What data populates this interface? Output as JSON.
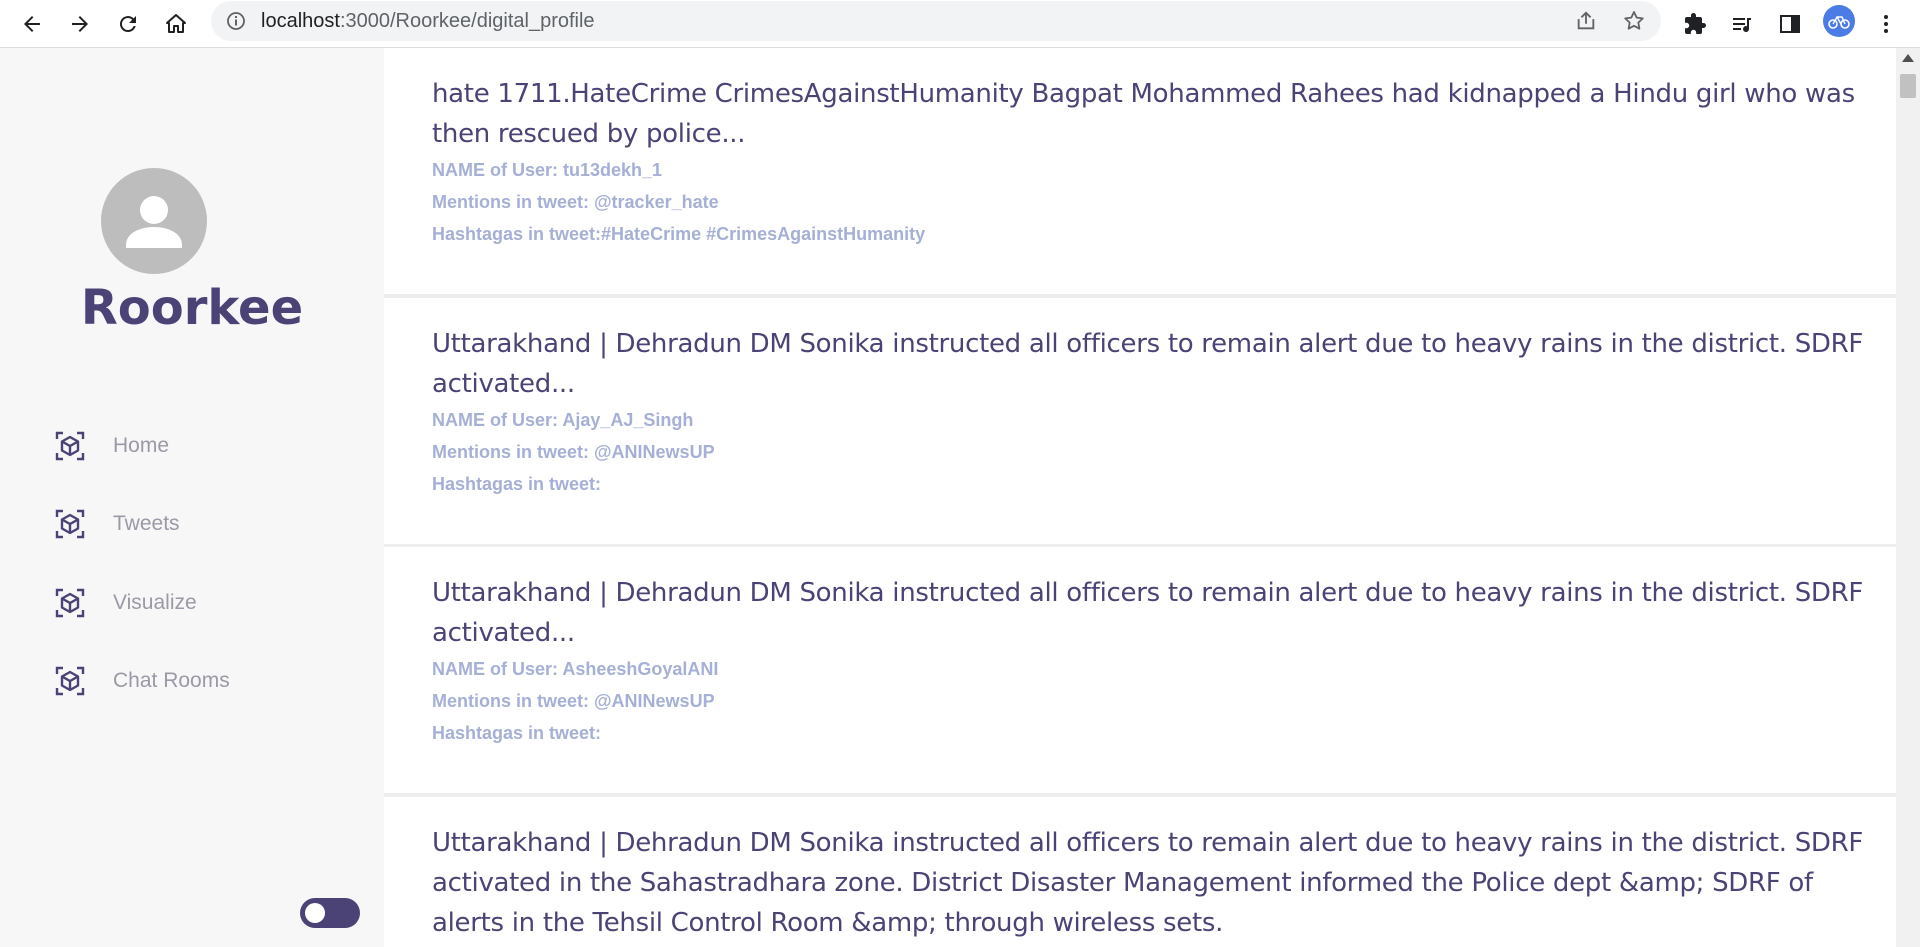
{
  "browser": {
    "url_host": "localhost",
    "url_path": ":3000/Roorkee/digital_profile"
  },
  "sidebar": {
    "title": "Roorkee",
    "items": [
      {
        "label": "Home",
        "icon": "cube-icon"
      },
      {
        "label": "Tweets",
        "icon": "cube-icon"
      },
      {
        "label": "Visualize",
        "icon": "cube-icon"
      },
      {
        "label": "Chat Rooms",
        "icon": "cube-icon"
      }
    ]
  },
  "tweets": [
    {
      "text": "hate 1711.HateCrime CrimesAgainstHumanity Bagpat Mohammed Rahees had kidnapped a Hindu girl who was then rescued by police...",
      "user": "NAME of User: tu13dekh_1",
      "mentions": "Mentions in tweet: @tracker_hate",
      "hashtags": "Hashtagas in tweet:#HateCrime #CrimesAgainstHumanity"
    },
    {
      "text": "Uttarakhand | Dehradun DM Sonika instructed all officers to remain alert due to heavy rains in the district. SDRF activated...",
      "user": "NAME of User: Ajay_AJ_Singh",
      "mentions": "Mentions in tweet: @ANINewsUP",
      "hashtags": "Hashtagas in tweet:"
    },
    {
      "text": "Uttarakhand | Dehradun DM Sonika instructed all officers to remain alert due to heavy rains in the district. SDRF activated...",
      "user": "NAME of User: AsheeshGoyalANI",
      "mentions": "Mentions in tweet: @ANINewsUP",
      "hashtags": "Hashtagas in tweet:"
    },
    {
      "text": "Uttarakhand | Dehradun DM Sonika instructed all officers to remain alert due to heavy rains in the district. SDRF activated in the Sahastradhara zone. District Disaster Management informed the Police dept &amp; SDRF of alerts in the Tehsil Control Room &amp; through wireless sets."
    }
  ],
  "colors": {
    "accent": "#4b4376",
    "meta_text": "#a6afd6",
    "sidebar_bg": "#f7f7f8"
  }
}
